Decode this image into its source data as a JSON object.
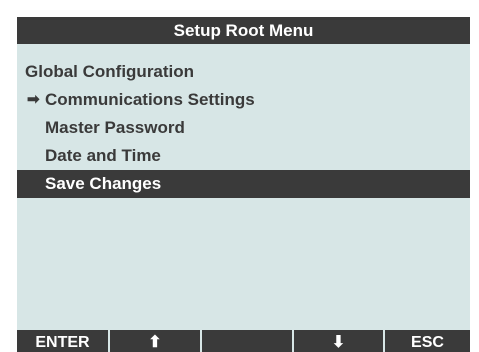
{
  "title": "Setup Root Menu",
  "menu": {
    "items": [
      {
        "label": "Global Configuration"
      },
      {
        "label": "Communications Settings"
      },
      {
        "label": "Master Password"
      },
      {
        "label": "Date and Time"
      },
      {
        "label": "Save Changes"
      }
    ],
    "pointer_glyph": "➡",
    "pointer_at_item": "Communications Settings",
    "selected_item": "Save Changes"
  },
  "softkeys": [
    {
      "label": "ENTER"
    },
    {
      "label": "⬆",
      "icon": "up-arrow-icon"
    },
    {
      "label": ""
    },
    {
      "label": "⬇",
      "icon": "down-arrow-icon"
    },
    {
      "label": "ESC"
    }
  ],
  "colors": {
    "screen_background": "#d7e6e6",
    "bar_and_text": "#3a3a3a",
    "inverse_text": "#ffffff"
  }
}
